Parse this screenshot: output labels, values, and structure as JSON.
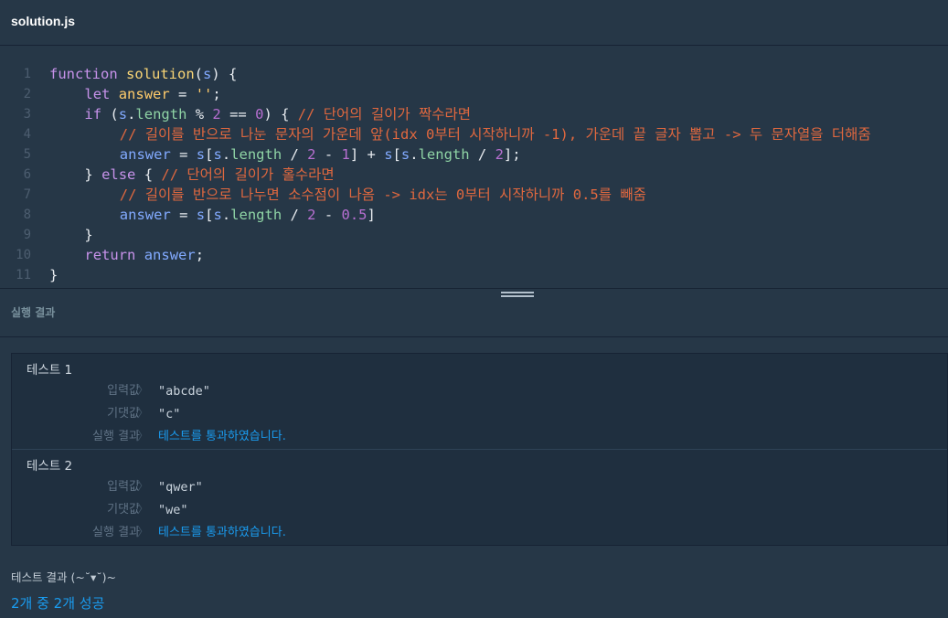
{
  "tab": {
    "filename": "solution.js"
  },
  "editor": {
    "lines": [
      {
        "n": "1",
        "indent": 0,
        "tokens": [
          [
            "kw",
            "function "
          ],
          [
            "fn",
            "solution"
          ],
          [
            "pl",
            "("
          ],
          [
            "var",
            "s"
          ],
          [
            "pl",
            ") {"
          ]
        ]
      },
      {
        "n": "2",
        "indent": 1,
        "tokens": [
          [
            "kw",
            "let "
          ],
          [
            "str",
            "answer"
          ],
          [
            "op",
            " = "
          ],
          [
            "str",
            "''"
          ],
          [
            "pl",
            ";"
          ]
        ]
      },
      {
        "n": "3",
        "indent": 1,
        "tokens": [
          [
            "kw",
            "if "
          ],
          [
            "pl",
            "("
          ],
          [
            "var",
            "s"
          ],
          [
            "pl",
            "."
          ],
          [
            "prop",
            "length"
          ],
          [
            "op",
            " % "
          ],
          [
            "num",
            "2"
          ],
          [
            "op",
            " == "
          ],
          [
            "num",
            "0"
          ],
          [
            "pl",
            ") { "
          ],
          [
            "cm",
            "// 단어의 길이가 짝수라면"
          ]
        ]
      },
      {
        "n": "4",
        "indent": 2,
        "tokens": [
          [
            "cm",
            "// 길이를 반으로 나눈 문자의 가운데 앞(idx 0부터 시작하니까 -1), 가운데 끝 글자 뽑고 -> 두 문자열을 더해줌"
          ]
        ]
      },
      {
        "n": "5",
        "indent": 2,
        "tokens": [
          [
            "var",
            "answer"
          ],
          [
            "op",
            " = "
          ],
          [
            "var",
            "s"
          ],
          [
            "pl",
            "["
          ],
          [
            "var",
            "s"
          ],
          [
            "pl",
            "."
          ],
          [
            "prop",
            "length"
          ],
          [
            "op",
            " / "
          ],
          [
            "num",
            "2"
          ],
          [
            "op",
            " - "
          ],
          [
            "num",
            "1"
          ],
          [
            "pl",
            "]"
          ],
          [
            "op",
            " + "
          ],
          [
            "var",
            "s"
          ],
          [
            "pl",
            "["
          ],
          [
            "var",
            "s"
          ],
          [
            "pl",
            "."
          ],
          [
            "prop",
            "length"
          ],
          [
            "op",
            " / "
          ],
          [
            "num",
            "2"
          ],
          [
            "pl",
            "];"
          ]
        ]
      },
      {
        "n": "6",
        "indent": 1,
        "tokens": [
          [
            "pl",
            "} "
          ],
          [
            "kw",
            "else"
          ],
          [
            "pl",
            " { "
          ],
          [
            "cm",
            "// 단어의 길이가 홀수라면"
          ]
        ]
      },
      {
        "n": "7",
        "indent": 2,
        "tokens": [
          [
            "cm",
            "// 길이를 반으로 나누면 소수점이 나옴 -> idx는 0부터 시작하니까 0.5를 빼줌"
          ]
        ]
      },
      {
        "n": "8",
        "indent": 2,
        "tokens": [
          [
            "var",
            "answer"
          ],
          [
            "op",
            " = "
          ],
          [
            "var",
            "s"
          ],
          [
            "pl",
            "["
          ],
          [
            "var",
            "s"
          ],
          [
            "pl",
            "."
          ],
          [
            "prop",
            "length"
          ],
          [
            "op",
            " / "
          ],
          [
            "num",
            "2"
          ],
          [
            "op",
            " - "
          ],
          [
            "num",
            "0.5"
          ],
          [
            "pl",
            "]"
          ]
        ]
      },
      {
        "n": "9",
        "indent": 1,
        "tokens": [
          [
            "pl",
            "}"
          ]
        ]
      },
      {
        "n": "10",
        "indent": 1,
        "tokens": [
          [
            "kw",
            "return "
          ],
          [
            "var",
            "answer"
          ],
          [
            "pl",
            ";"
          ]
        ]
      },
      {
        "n": "11",
        "indent": 0,
        "tokens": [
          [
            "pl",
            "}"
          ]
        ]
      }
    ]
  },
  "results": {
    "title": "실행 결과",
    "label_input": "입력값",
    "label_expected": "기댓값",
    "label_result": "실행 결과",
    "chevron": "〉",
    "tests": [
      {
        "name": "테스트 1",
        "input": "\"abcde\"",
        "expected": "\"c\"",
        "result": "테스트를 통과하였습니다."
      },
      {
        "name": "테스트 2",
        "input": "\"qwer\"",
        "expected": "\"we\"",
        "result": "테스트를 통과하였습니다."
      }
    ]
  },
  "summary": {
    "label": "테스트 결과 (~˘▾˘)~",
    "value": "2개 중 2개 성공"
  },
  "colors": {
    "background": "#263747",
    "panel": "#1f2f3f",
    "pass": "#1a9cf0",
    "comment": "#e0683f",
    "keyword": "#c792ea",
    "function": "#fad676",
    "number": "#b76fd1"
  }
}
